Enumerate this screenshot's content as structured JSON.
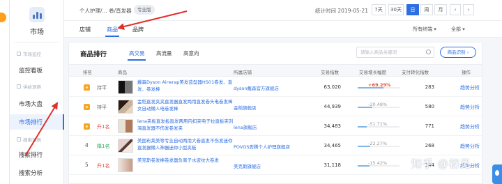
{
  "sidebar": {
    "brand_label": "市场",
    "sections": [
      {
        "label": "市场监控",
        "items": [
          "监控看板"
        ]
      },
      {
        "label": "供给洞察",
        "items": [
          "市场大盘",
          "市场排行"
        ]
      },
      {
        "label": "搜索洞察",
        "items": [
          "搜索排行",
          "搜索分析"
        ]
      }
    ],
    "active_item": "市场排行"
  },
  "topbar": {
    "breadcrumb": "个人护理/... 卷/直发器",
    "tag": "专业版",
    "stat_time": "统计时间 2019-05-21",
    "ranges": [
      "7天",
      "30天",
      "日",
      "周",
      "月"
    ],
    "active_range": "日",
    "prev": "‹",
    "next": "›"
  },
  "tabs": {
    "items": [
      "店铺",
      "商品",
      "品牌"
    ],
    "active": "商品",
    "filter1": "所有终端",
    "filter2": "全部"
  },
  "ranking": {
    "title": "商品排行",
    "subtabs": [
      "高交易",
      "高流量",
      "高意向"
    ],
    "active_subtab": "高交易",
    "search_placeholder": "请输入商品关键词",
    "compare_button": "商品识别",
    "headers": [
      "排名",
      "商品",
      "所属店铺",
      "交易指数",
      "交易增长幅度",
      "支付转化指数",
      "操作"
    ],
    "rows": [
      {
        "rank": "1",
        "change": "持平",
        "change_type": "flat",
        "name": "戴森Dyson Airwrap美发造型器HS01卷发、直发、卷发棒",
        "shop": "dyson戴森官方旗舰店",
        "index": "63,020",
        "growth": "+69.29%",
        "growth_hi": true,
        "growth_fill": 0.62,
        "conv": "283",
        "op": "趋势分析"
      },
      {
        "rank": "2",
        "change": "持平",
        "change_type": "flat",
        "name": "金稻直发夹夹直发器直发两用直发卷头电卷发棒女自动懒人电卷发棒",
        "shop": "金稻旗舰店",
        "index": "44,939",
        "growth": "-20.48%",
        "growth_hi": false,
        "growth_fill": 0.35,
        "conv": "580",
        "op": "趋势分析"
      },
      {
        "rank": "3",
        "change": "升1名",
        "change_type": "up",
        "name": "lena夹板直发板直发两用内扣夹电子拉直板夹刘海直发器不伤发卷发夹",
        "shop": "lena旗舰店",
        "index": "34,483",
        "growth": "-51.71%",
        "growth_hi": false,
        "growth_fill": 0.22,
        "conv": "771",
        "op": "趋势分析"
      },
      {
        "rank": "4",
        "change": "降1名",
        "change_type": "down",
        "name": "美国布莱美等专业自动两用大卷直发不伤发迷你直发器懒人神器迷你小型夹板",
        "shop": "POVOS奔腾个人护理旗舰店",
        "index": "34,465",
        "growth": "-22.27%",
        "growth_hi": false,
        "growth_fill": 0.3,
        "conv": "268",
        "op": "趋势分析"
      },
      {
        "rank": "5",
        "change": "升1名",
        "change_type": "up",
        "name": "美克斯卷发棒卷发器负离子水波纹大卷发",
        "shop": "美克斯旗舰店",
        "index": "31,118",
        "growth": "-15.42%",
        "growth_hi": false,
        "growth_fill": 0.28,
        "conv": "344",
        "op": "趋势分析"
      }
    ]
  },
  "watermark": "知乎 @初见",
  "colors": {
    "accent": "#2d6ee2",
    "annotation": "#e0302a",
    "gold": "#f5a623"
  }
}
